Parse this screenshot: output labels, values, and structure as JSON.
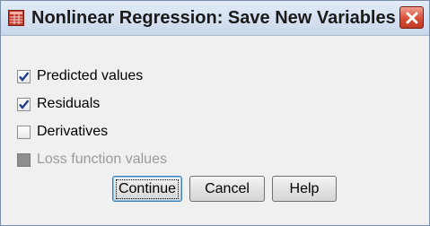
{
  "window": {
    "title": "Nonlinear Regression: Save New Variables"
  },
  "options": [
    {
      "label": "Predicted values",
      "checked": true,
      "disabled": false
    },
    {
      "label": "Residuals",
      "checked": true,
      "disabled": false
    },
    {
      "label": "Derivatives",
      "checked": false,
      "disabled": false
    },
    {
      "label": "Loss function values",
      "checked": false,
      "disabled": true
    }
  ],
  "buttons": {
    "continue_label": "Continue",
    "cancel_label": "Cancel",
    "help_label": "Help"
  },
  "icons": {
    "app": "spss-table-icon",
    "close": "close-icon",
    "check": "checkmark-icon"
  }
}
